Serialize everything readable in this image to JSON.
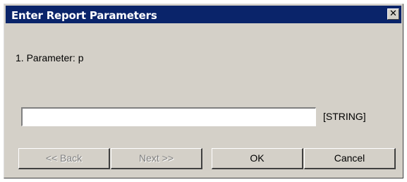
{
  "dialog": {
    "title": "Enter Report Parameters",
    "close_glyph": "✕"
  },
  "parameter": {
    "label": "1. Parameter:  p",
    "value": "",
    "type": "[STRING]"
  },
  "buttons": {
    "back": "<< Back",
    "next": "Next >>",
    "ok": "OK",
    "cancel": "Cancel"
  },
  "colors": {
    "titlebar": "#0a246a",
    "dialog_bg": "#d4d0c8"
  }
}
